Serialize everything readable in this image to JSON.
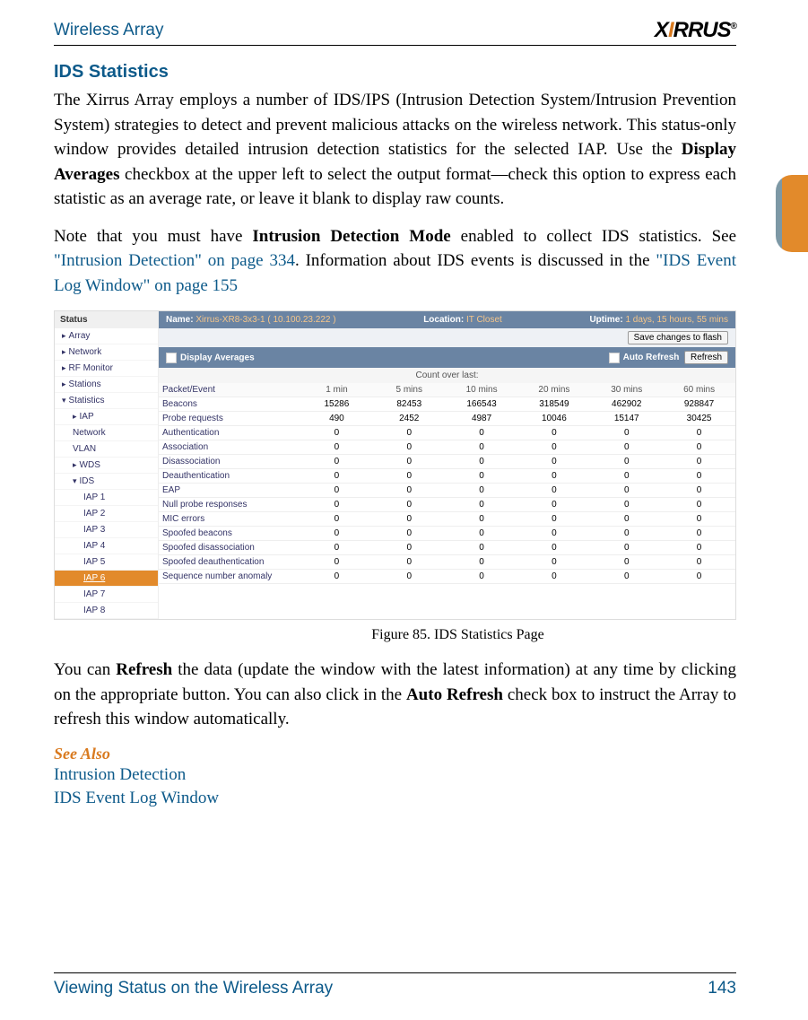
{
  "header": {
    "left": "Wireless Array",
    "logo_pre": "X",
    "logo_mid_i": "I",
    "logo_rest": "RRUS",
    "logo_reg": "®"
  },
  "title": "IDS Statistics",
  "para1_a": "The Xirrus Array employs a number of IDS/IPS (Intrusion Detection System/Intrusion Prevention System) strategies to detect and prevent malicious attacks on the wireless network. This status-only window provides detailed intrusion detection statistics for the selected IAP. Use the ",
  "para1_b_bold": "Display Averages",
  "para1_c": " checkbox at the upper left to select the output format—check this option to express each statistic as an average rate, or leave it blank to display raw counts.",
  "para2_a": "Note that you must have ",
  "para2_b_bold": "Intrusion Detection Mode",
  "para2_c": " enabled to collect IDS statistics. See ",
  "para2_link1": "\"Intrusion Detection\" on page 334",
  "para2_d": ". Information about IDS events is discussed in the ",
  "para2_link2": "\"IDS Event Log Window\" on page 155",
  "screenshot": {
    "status_head": "Status",
    "nav": {
      "array": "Array",
      "network": "Network",
      "rfmonitor": "RF Monitor",
      "stations": "Stations",
      "statistics": "Statistics",
      "iap": "IAP",
      "network2": "Network",
      "vlan": "VLAN",
      "wds": "WDS",
      "ids": "IDS",
      "iap1": "IAP 1",
      "iap2": "IAP 2",
      "iap3": "IAP 3",
      "iap4": "IAP 4",
      "iap5": "IAP 5",
      "iap6": "IAP 6",
      "iap7": "IAP 7",
      "iap8": "IAP 8"
    },
    "topbar": {
      "name_lbl": "Name:",
      "name_val": "Xirrus-XR8-3x3-1   ( 10.100.23.222 )",
      "loc_lbl": "Location:",
      "loc_val": "IT Closet",
      "up_lbl": "Uptime:",
      "up_val": "1 days, 15 hours, 55 mins"
    },
    "save_btn": "Save changes to flash",
    "display_avg": "Display Averages",
    "auto_refresh": "Auto Refresh",
    "refresh": "Refresh",
    "count_label": "Count over last:",
    "cols": [
      "Packet/Event",
      "1 min",
      "5 mins",
      "10 mins",
      "20 mins",
      "30 mins",
      "60 mins"
    ],
    "rows": [
      {
        "label": "Beacons",
        "v": [
          "15286",
          "82453",
          "166543",
          "318549",
          "462902",
          "928847"
        ]
      },
      {
        "label": "Probe requests",
        "v": [
          "490",
          "2452",
          "4987",
          "10046",
          "15147",
          "30425"
        ]
      },
      {
        "label": "Authentication",
        "v": [
          "0",
          "0",
          "0",
          "0",
          "0",
          "0"
        ]
      },
      {
        "label": "Association",
        "v": [
          "0",
          "0",
          "0",
          "0",
          "0",
          "0"
        ]
      },
      {
        "label": "Disassociation",
        "v": [
          "0",
          "0",
          "0",
          "0",
          "0",
          "0"
        ]
      },
      {
        "label": "Deauthentication",
        "v": [
          "0",
          "0",
          "0",
          "0",
          "0",
          "0"
        ]
      },
      {
        "label": "EAP",
        "v": [
          "0",
          "0",
          "0",
          "0",
          "0",
          "0"
        ]
      },
      {
        "label": "Null probe responses",
        "v": [
          "0",
          "0",
          "0",
          "0",
          "0",
          "0"
        ]
      },
      {
        "label": "MIC errors",
        "v": [
          "0",
          "0",
          "0",
          "0",
          "0",
          "0"
        ]
      },
      {
        "label": "Spoofed beacons",
        "v": [
          "0",
          "0",
          "0",
          "0",
          "0",
          "0"
        ]
      },
      {
        "label": "Spoofed disassociation",
        "v": [
          "0",
          "0",
          "0",
          "0",
          "0",
          "0"
        ]
      },
      {
        "label": "Spoofed deauthentication",
        "v": [
          "0",
          "0",
          "0",
          "0",
          "0",
          "0"
        ]
      },
      {
        "label": "Sequence number anomaly",
        "v": [
          "0",
          "0",
          "0",
          "0",
          "0",
          "0"
        ]
      }
    ]
  },
  "figure_caption": "Figure 85. IDS Statistics Page",
  "para3_a": "You can ",
  "para3_b_bold": "Refresh",
  "para3_c": " the data (update the window with the latest information) at any time by clicking on the appropriate button. You can also click in the ",
  "para3_d_bold": "Auto Refresh",
  "para3_e": " check box to instruct the Array to refresh this window automatically.",
  "see_also_head": "See Also",
  "see_also_1": "Intrusion Detection",
  "see_also_2": "IDS Event Log Window",
  "footer_left": "Viewing Status on the Wireless Array",
  "footer_right": "143"
}
